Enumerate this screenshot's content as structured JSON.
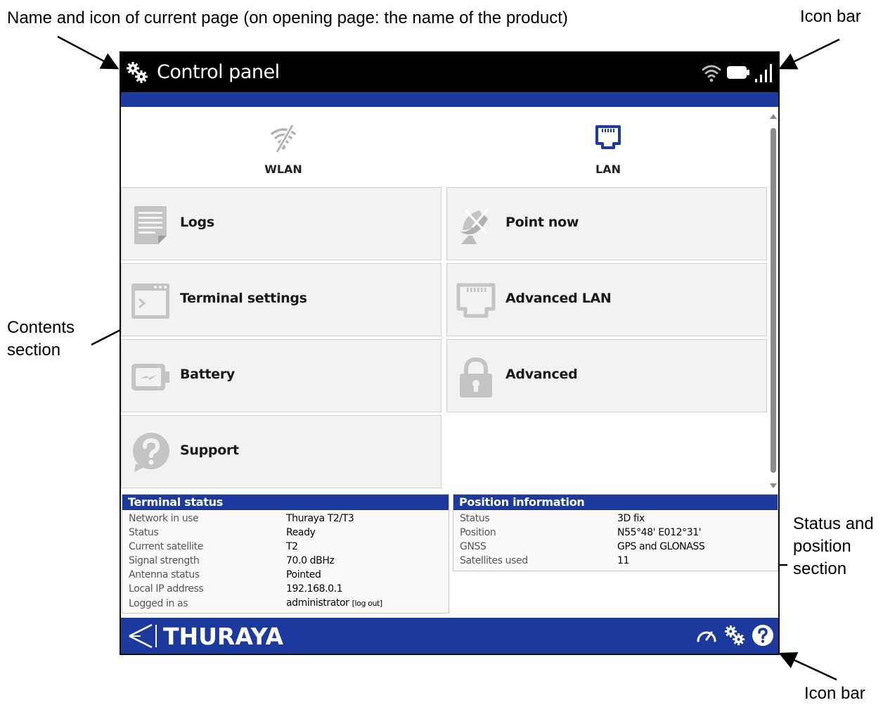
{
  "annotations": {
    "page_name": "Name and icon of current page (on opening page: the name of the product)",
    "icon_bar_top": "Icon bar",
    "contents": [
      "Contents",
      "section"
    ],
    "status_position": [
      "Status and",
      "position",
      "section"
    ],
    "icon_bar_bottom": "Icon bar"
  },
  "header": {
    "title": "Control panel",
    "icons": [
      "wifi-icon",
      "battery-icon",
      "signal-strength-icon"
    ]
  },
  "top_links": [
    {
      "label": "WLAN",
      "icon": "wlan-off-icon"
    },
    {
      "label": "LAN",
      "icon": "lan-port-icon"
    }
  ],
  "tiles": [
    {
      "label": "Logs",
      "icon": "logs-icon"
    },
    {
      "label": "Point now",
      "icon": "satellite-dish-icon"
    },
    {
      "label": "Terminal settings",
      "icon": "terminal-settings-icon"
    },
    {
      "label": "Advanced LAN",
      "icon": "advanced-lan-icon"
    },
    {
      "label": "Battery",
      "icon": "battery-icon"
    },
    {
      "label": "Advanced",
      "icon": "lock-icon"
    },
    {
      "label": "Support",
      "icon": "support-question-icon"
    }
  ],
  "terminal_status": {
    "title": "Terminal status",
    "rows": [
      {
        "key": "Network in use",
        "value": "Thuraya T2/T3"
      },
      {
        "key": "Status",
        "value": "Ready"
      },
      {
        "key": "Current satellite",
        "value": "T2"
      },
      {
        "key": "Signal strength",
        "value": "70.0 dBHz"
      },
      {
        "key": "Antenna status",
        "value": "Pointed"
      },
      {
        "key": "Local IP address",
        "value": "192.168.0.1"
      },
      {
        "key": "Logged in as",
        "value": "administrator",
        "link": "[log out]"
      }
    ]
  },
  "position_info": {
    "title": "Position information",
    "rows": [
      {
        "key": "Status",
        "value": "3D fix"
      },
      {
        "key": "Position",
        "value": "N55°48' E012°31'"
      },
      {
        "key": "GNSS",
        "value": "GPS and GLONASS"
      },
      {
        "key": "Satellites used",
        "value": "11"
      }
    ]
  },
  "footer": {
    "brand": "THURAYA",
    "icons": [
      "dashboard-icon",
      "control-panel-gear-icon",
      "help-icon"
    ]
  },
  "colors": {
    "topbar": "#000000",
    "brand_blue": "#1c3a9e",
    "tile_bg": "#f2f2f2",
    "icon_gray": "#bdbdbd",
    "lan_icon_blue": "#1c3a9e"
  }
}
